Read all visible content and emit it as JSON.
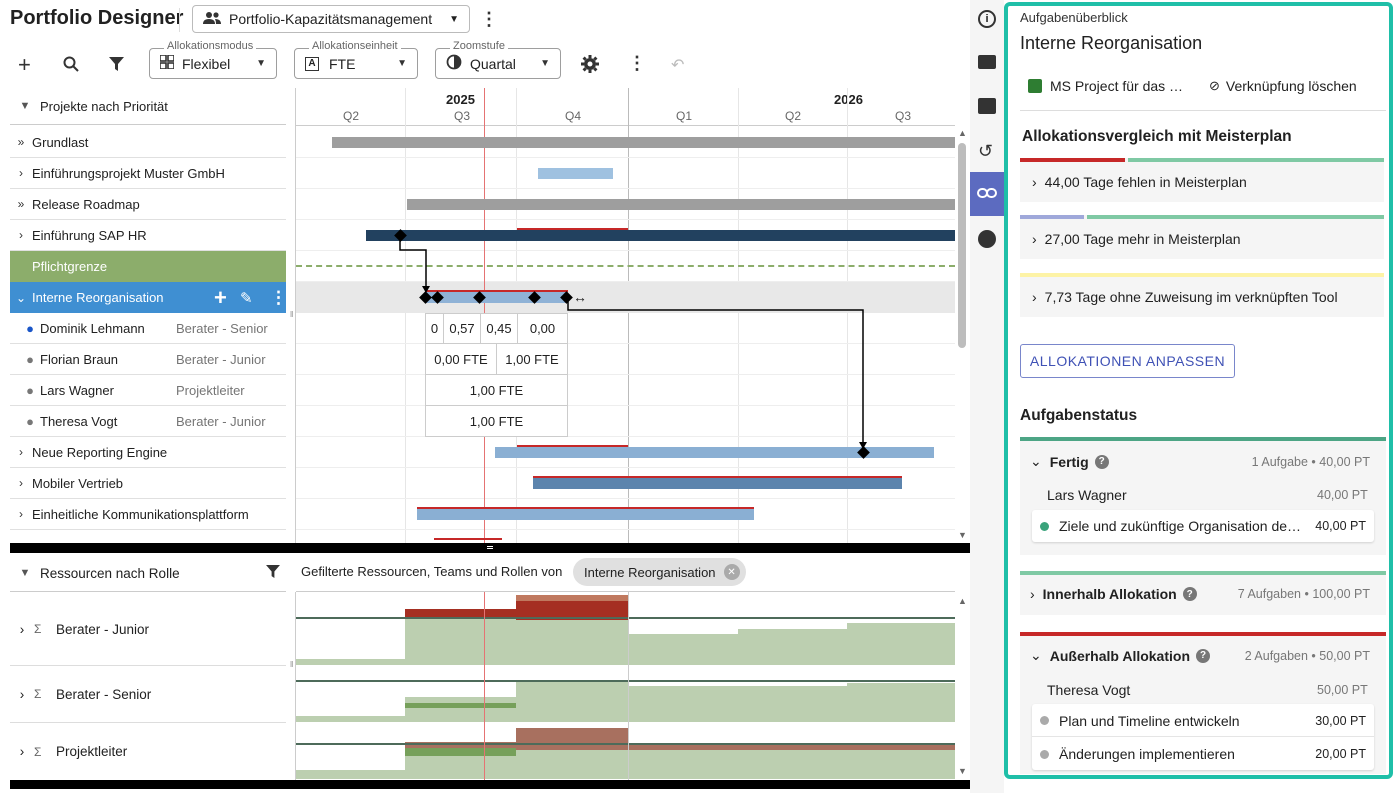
{
  "app": {
    "title": "Portfolio Designer",
    "portfolio": "Portfolio-Kapazitätsmanagement"
  },
  "toolbar": {
    "alloc_mode": {
      "label": "Allokationsmodus",
      "value": "Flexibel"
    },
    "alloc_unit": {
      "label": "Allokationseinheit",
      "value": "FTE"
    },
    "zoom": {
      "label": "Zoomstufe",
      "value": "Quartal"
    }
  },
  "projects": {
    "header": "Projekte nach Priorität",
    "rows": [
      {
        "name": "Grundlast"
      },
      {
        "name": "Einführungsprojekt Muster GmbH"
      },
      {
        "name": "Release Roadmap"
      },
      {
        "name": "Einführung SAP HR"
      },
      {
        "name": "Pflichtgrenze"
      },
      {
        "name": "Interne Reorganisation"
      },
      {
        "name": "Dominik Lehmann",
        "role": "Berater - Senior"
      },
      {
        "name": "Florian Braun",
        "role": "Berater - Junior"
      },
      {
        "name": "Lars Wagner",
        "role": "Projektleiter"
      },
      {
        "name": "Theresa Vogt",
        "role": "Berater - Junior"
      },
      {
        "name": "Neue Reporting Engine"
      },
      {
        "name": "Mobiler Vertrieb"
      },
      {
        "name": "Einheitliche Kommunikationsplattform"
      }
    ]
  },
  "timeline": {
    "years": [
      "2025",
      "2026"
    ],
    "quarters": [
      "Q2",
      "Q3",
      "Q4",
      "Q1",
      "Q2",
      "Q3"
    ]
  },
  "alloc_values": {
    "dominik": [
      "0",
      "0,57",
      "0,45",
      "0,00"
    ],
    "florian": [
      "0,00 FTE",
      "1,00 FTE"
    ],
    "lars": "1,00 FTE",
    "theresa": "1,00 FTE"
  },
  "resources": {
    "header": "Ressourcen nach Rolle",
    "filter_text": "Gefilterte Ressourcen, Teams und Rollen von",
    "filter_chip": "Interne Reorganisation",
    "rows": [
      {
        "name": "Berater - Junior"
      },
      {
        "name": "Berater - Senior"
      },
      {
        "name": "Projektleiter"
      }
    ]
  },
  "panel": {
    "overline": "Aufgabenüberblick",
    "title": "Interne Reorganisation",
    "ms_project": "MS Project für das …",
    "unlink": "Verknüpfung löschen",
    "compare_title": "Allokationsvergleich mit Meisterplan",
    "compare": [
      {
        "label": "44,00 Tage fehlen in Meisterplan"
      },
      {
        "label": "27,00 Tage mehr in Meisterplan"
      },
      {
        "label": "7,73 Tage ohne Zuweisung im verknüpften Tool"
      }
    ],
    "adjust_button": "ALLOKATIONEN ANPASSEN",
    "status_title": "Aufgabenstatus",
    "done": {
      "label": "Fertig",
      "meta": "1 Aufgabe • 40,00 PT",
      "person": "Lars Wagner",
      "person_pt": "40,00 PT",
      "task": "Ziele und zukünftige Organisation de…",
      "task_pt": "40,00 PT"
    },
    "inside": {
      "label": "Innerhalb Allokation",
      "meta": "7 Aufgaben • 100,00 PT"
    },
    "outside": {
      "label": "Außerhalb Allokation",
      "meta": "2 Aufgaben • 50,00 PT",
      "person": "Theresa Vogt",
      "person_pt": "50,00 PT",
      "tasks": [
        {
          "name": "Plan und Timeline entwickeln",
          "pt": "30,00 PT"
        },
        {
          "name": "Änderungen implementieren",
          "pt": "20,00 PT"
        }
      ]
    }
  },
  "colors": {
    "accent": "#1fbfa8",
    "selected_row": "#3f8fd2",
    "mandatory": "#8cad6b",
    "panel_tab": "#5c6bc0"
  }
}
